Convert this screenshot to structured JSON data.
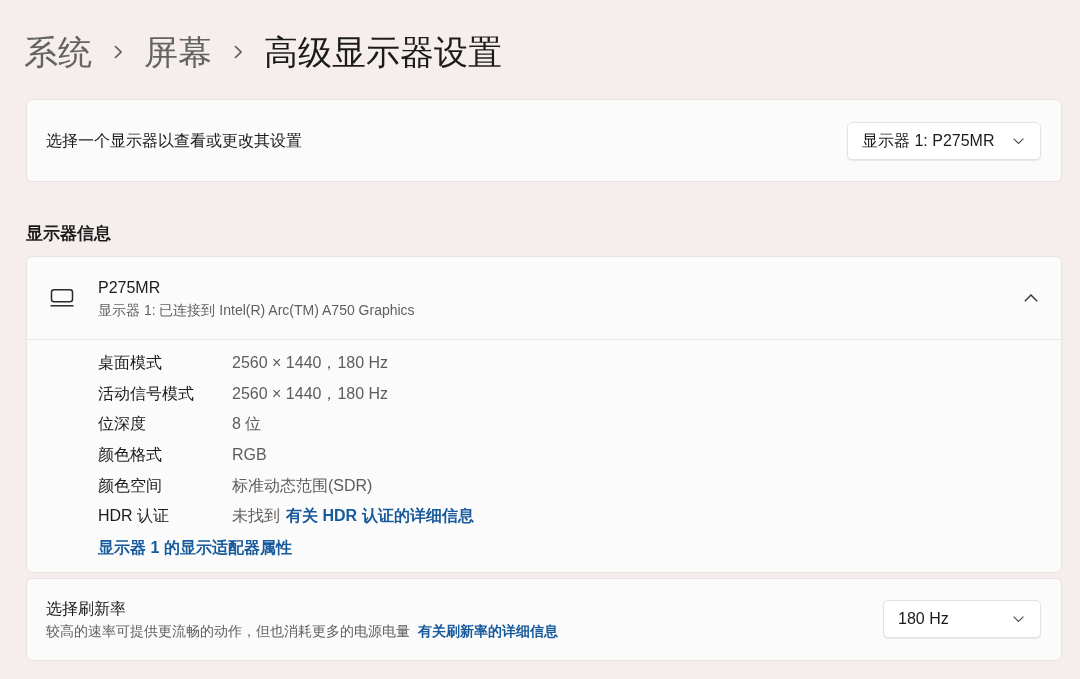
{
  "breadcrumb": [
    {
      "label": "系统",
      "current": false
    },
    {
      "label": "屏幕",
      "current": false
    },
    {
      "label": "高级显示器设置",
      "current": true
    }
  ],
  "display_select": {
    "label": "选择一个显示器以查看或更改其设置",
    "value": "显示器 1: P275MR"
  },
  "section_title": "显示器信息",
  "display_info": {
    "name": "P275MR",
    "subtitle": "显示器 1: 已连接到 Intel(R) Arc(TM) A750 Graphics",
    "expanded": true,
    "rows": [
      {
        "label": "桌面模式",
        "value": "2560 × 1440，180 Hz"
      },
      {
        "label": "活动信号模式",
        "value": "2560 × 1440，180 Hz"
      },
      {
        "label": "位深度",
        "value": "8 位"
      },
      {
        "label": "颜色格式",
        "value": "RGB"
      },
      {
        "label": "颜色空间",
        "value": "标准动态范围(SDR)"
      },
      {
        "label": "HDR 认证",
        "value": "未找到",
        "link": "有关 HDR 认证的详细信息"
      }
    ],
    "adapter_link": "显示器 1 的显示适配器属性"
  },
  "refresh_rate": {
    "title": "选择刷新率",
    "description": "较高的速率可提供更流畅的动作，但也消耗更多的电源电量",
    "link": "有关刷新率的详细信息",
    "value": "180 Hz"
  }
}
